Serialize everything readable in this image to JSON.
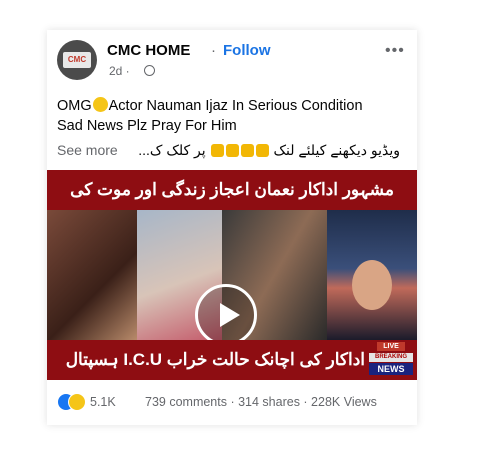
{
  "header": {
    "page_name": "CMC HOME",
    "separator": "·",
    "follow_label": "Follow",
    "timestamp": "2d ·",
    "more_label": "•••"
  },
  "post": {
    "text_part1": "OMG",
    "text_part2": "Actor Nauman Ijaz In Serious Condition",
    "text_line2": "Sad News Plz Pray For Him",
    "see_more": "See more",
    "urdu_line_a": "ویڈیو دیکھنے کیلئے لنک",
    "urdu_line_b": "پر کلک ک..."
  },
  "video": {
    "top_banner": "مشہور اداکار نعمان اعجاز زندگی اور موت کی کشمکش میں",
    "bottom_banner": "اداکار کی اچانک حالت خراب I.C.U ہسپتال کرد",
    "live": "LIVE",
    "breaking": "BREAKING",
    "news": "NEWS"
  },
  "footer": {
    "reactions_count": "5.1K",
    "stats": "739 comments · 314 shares · 228K Views"
  },
  "colors": {
    "accent": "#1b74e4",
    "banner": "#8e0d12"
  }
}
